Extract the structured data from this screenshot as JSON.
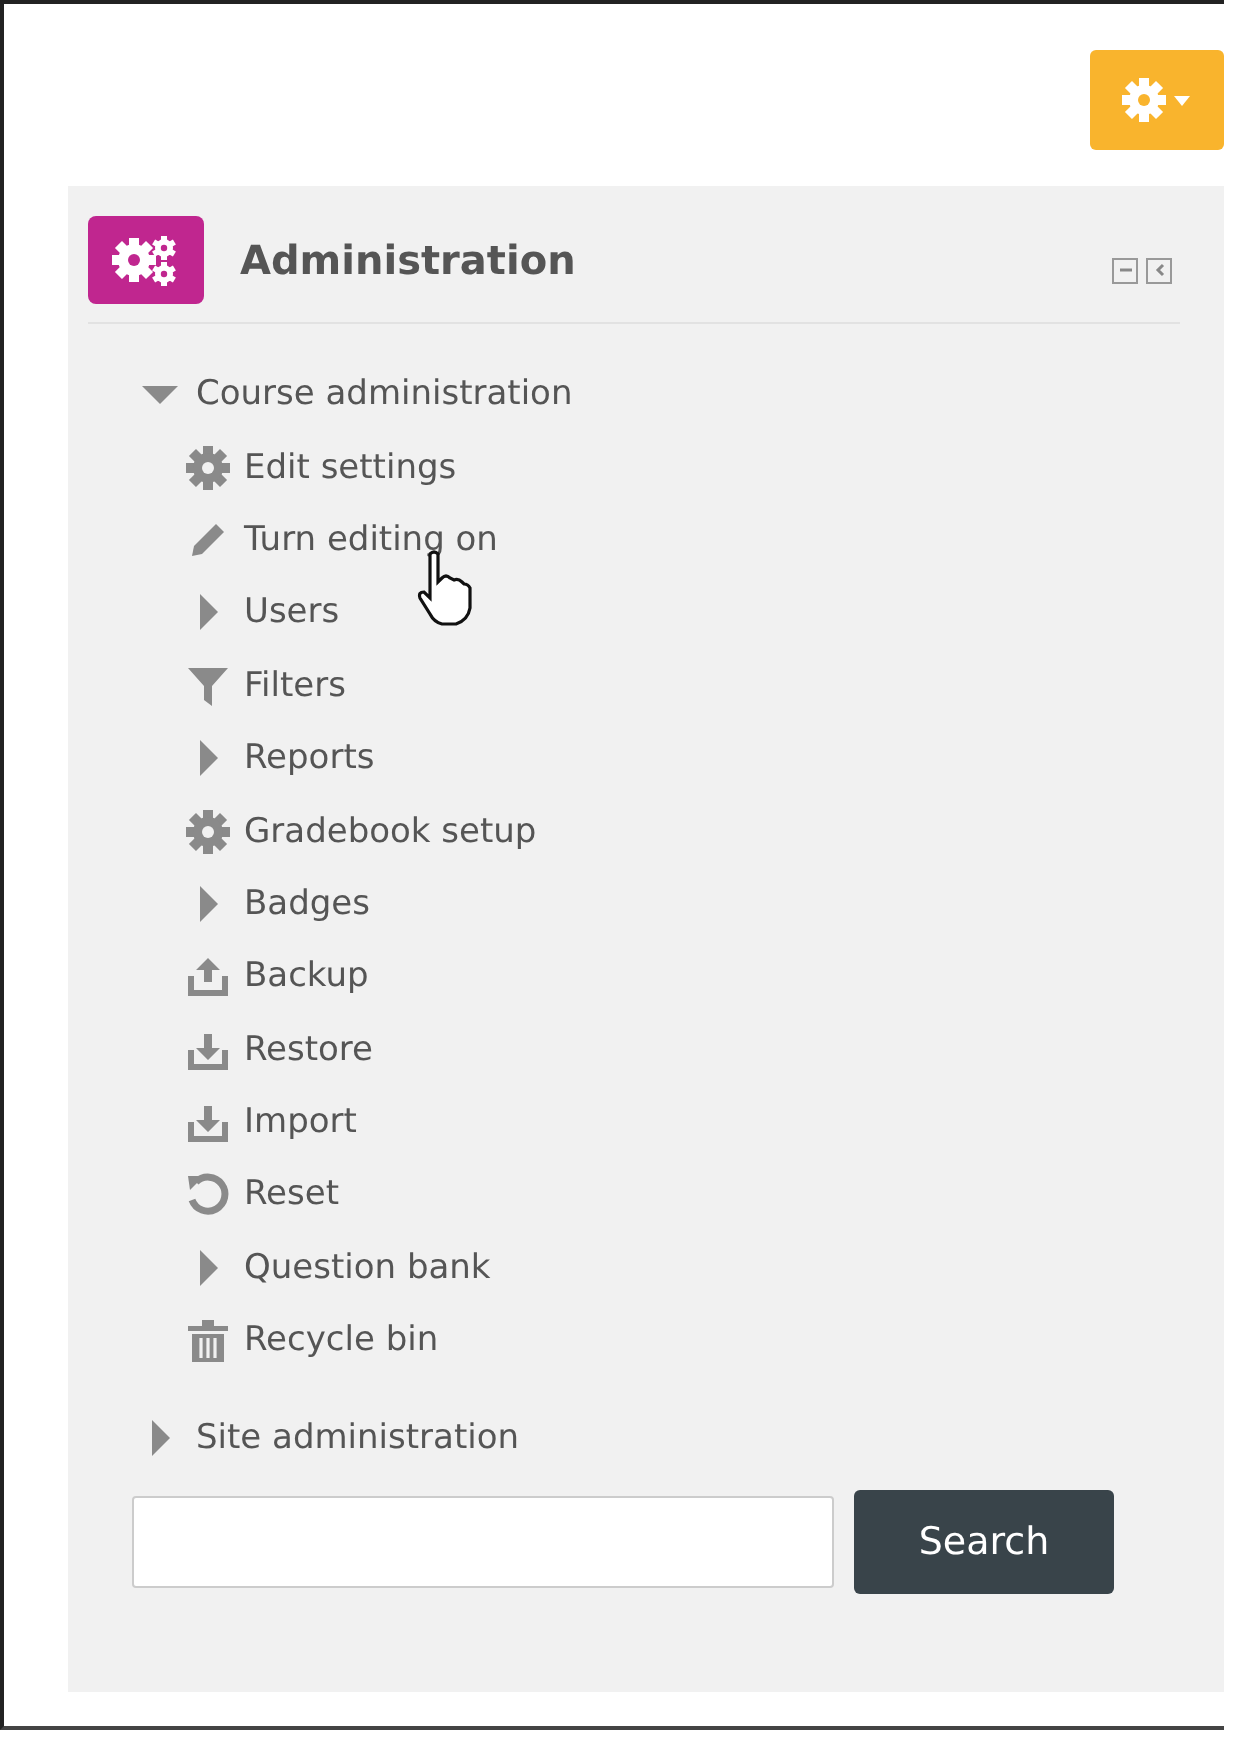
{
  "block": {
    "title": "Administration",
    "tree": [
      {
        "label": "Course administration",
        "kind": "branch",
        "expanded": true,
        "children": [
          {
            "label": "Edit settings",
            "kind": "settings"
          },
          {
            "label": "Turn editing on",
            "kind": "edit"
          },
          {
            "label": "Users",
            "kind": "branch",
            "expanded": false
          },
          {
            "label": "Filters",
            "kind": "filter"
          },
          {
            "label": "Reports",
            "kind": "branch",
            "expanded": false
          },
          {
            "label": "Gradebook setup",
            "kind": "settings"
          },
          {
            "label": "Badges",
            "kind": "branch",
            "expanded": false
          },
          {
            "label": "Backup",
            "kind": "backup"
          },
          {
            "label": "Restore",
            "kind": "restore"
          },
          {
            "label": "Import",
            "kind": "restore"
          },
          {
            "label": "Reset",
            "kind": "reset"
          },
          {
            "label": "Question bank",
            "kind": "branch",
            "expanded": false
          },
          {
            "label": "Recycle bin",
            "kind": "trash"
          }
        ]
      },
      {
        "label": "Site administration",
        "kind": "branch",
        "expanded": false
      }
    ],
    "search": {
      "button": "Search"
    }
  }
}
